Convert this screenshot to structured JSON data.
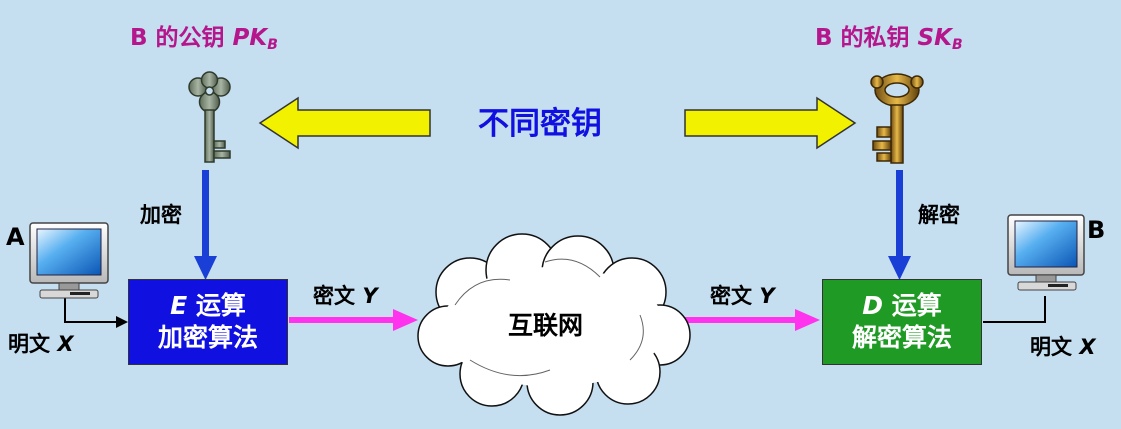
{
  "public_key": {
    "prefix": "B 的公钥 ",
    "symbol": "PK",
    "subscript": "B"
  },
  "private_key": {
    "prefix": "B 的私钥 ",
    "symbol": "SK",
    "subscript": "B"
  },
  "different_keys": "不同密钥",
  "encrypt_label": "加密",
  "decrypt_label": "解密",
  "host_a": "A",
  "host_b": "B",
  "plaintext_left": {
    "text": "明文 ",
    "var": "X"
  },
  "plaintext_right": {
    "text": "明文 ",
    "var": "X"
  },
  "ciphertext_left": {
    "text": "密文 ",
    "var": "Y"
  },
  "ciphertext_right": {
    "text": "密文 ",
    "var": "Y"
  },
  "encrypt_box": {
    "op": "E",
    "line1_suffix": " 运算",
    "line2": "加密算法"
  },
  "decrypt_box": {
    "op": "D",
    "line1_suffix": " 运算",
    "line2": "解密算法"
  },
  "internet": "互联网",
  "colors": {
    "background": "#c5def0",
    "encrypt_box": "#1010e0",
    "decrypt_box": "#1f9a24",
    "magenta": "#b5168c",
    "yellow_arrow": "#f2f200",
    "blue_arrow": "#1a3fd6",
    "pink_arrow": "#ff33ee"
  },
  "icons": [
    "monitor-icon",
    "key-icon",
    "cloud-icon"
  ]
}
